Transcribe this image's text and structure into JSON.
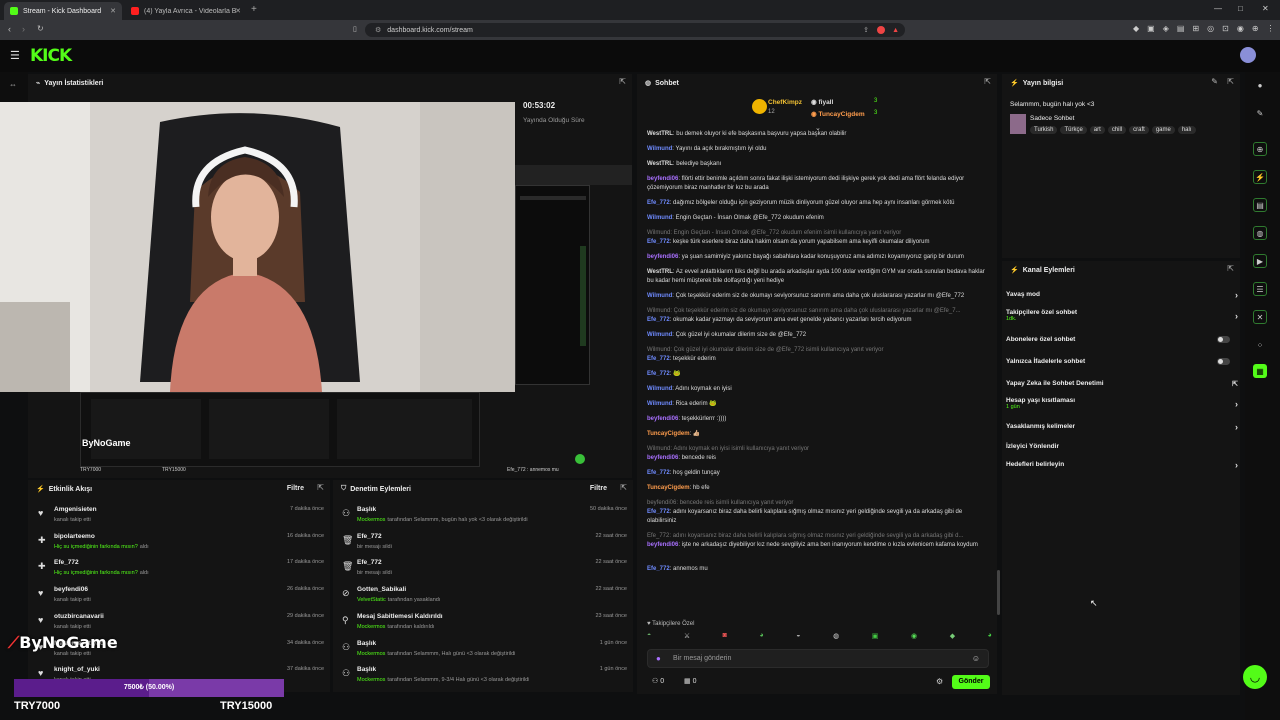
{
  "browser": {
    "tabs": [
      {
        "label": "Stream - Kick Dashboard",
        "active": true
      },
      {
        "label": "(4) Yayla Avrıca - Videolarla Bak (Yo...",
        "active": false
      }
    ],
    "url": "dashboard.kick.com/stream"
  },
  "brand": {
    "logo": "KICK",
    "accent": "#53fc18"
  },
  "stats_panel": {
    "title": "Yayın İstatistikleri",
    "uptime": "00:53:02",
    "uptime_label": "Yayında Olduğu Süre",
    "overlay_name": "ByNoGame",
    "stream_label_a": "TRY7000",
    "stream_label_b": "TRY15000",
    "chat_preview": "Efe_772 : annemos mu"
  },
  "chat": {
    "title": "Sohbet",
    "pinned": [
      {
        "name": "ChefKimpz",
        "count": "3",
        "sub": "12"
      },
      {
        "name": "fiyall",
        "count": "3"
      },
      {
        "name": "TuncayCigdem",
        "count": "3"
      }
    ],
    "messages": [
      {
        "user": "WestTRL",
        "color": "white",
        "text": "bu demek oluyor ki efe başkasına başvuru yapsa başkan olabilir"
      },
      {
        "user": "Wilmund",
        "color": "blue",
        "text": "Yayını da açık bırakmıştım iyi oldu"
      },
      {
        "user": "WestTRL",
        "color": "white",
        "text": "belediye başkanı"
      },
      {
        "user": "beyfendi06",
        "color": "purple",
        "text": "flörti ettir benimle açıldım sonra fakat ilişki istemiyorum dedi ilişkiye gerek yok dedi ama flört felanda ediyor çözemiyorum biraz manhatler bir kız bu arada"
      },
      {
        "user": "Efe_772",
        "color": "blue",
        "text": "dağımız bölgeler olduğu için geziyorum müzik dinliyorum güzel oluyor ama hep aynı insanları görmek kötü"
      },
      {
        "user": "Wilmund",
        "color": "blue",
        "text": "Engin Geçtan - İnsan Olmak @Efe_772 okudum efenim"
      },
      {
        "user": "Efe_772",
        "color": "blue",
        "reply": "Wilmund: Engin Geçtan - İnsan Olmak @Efe_772 okudum efenim isimli kullanıcıya yanıt veriyor",
        "text": "keşke türk eserlere biraz daha hakim olsam da yorum yapabilsem ama keyifli okumalar diliyorum"
      },
      {
        "user": "beyfendi06",
        "color": "purple",
        "text": "ya şuan samimiyiz yakınız bayağı sabahlara kadar konuşuyoruz ama adımızı koyamıyoruz garip bir durum"
      },
      {
        "user": "WestTRL",
        "color": "white",
        "text": "Az evvel anlattıklarım lüks değil bu arada arkadaşlar ayda 100 dolar verdiğim GYM var orada sunulan bedava haklar bu kadar hemi müşterek bile dolfaşrdığı yeni hediye"
      },
      {
        "user": "Wilmund",
        "color": "blue",
        "text": "Çok teşekkür ederim siz de okumayı seviyorsunuz sanırım ama daha çok uluslararası yazarlar mı @Efe_772"
      },
      {
        "user": "Efe_772",
        "color": "blue",
        "reply": "Wilmund: Çok teşekkür ederim siz de okumayı seviyorsunuz sanırım ama daha çok uluslararası yazarlar mı @Efe_7...",
        "text": "okumak kadar yazmayı da seviyorum ama evet genelde yabancı yazarları tercih ediyorum"
      },
      {
        "user": "Wilmund",
        "color": "blue",
        "text": "Çok güzel iyi okumalar dilerim size de @Efe_772"
      },
      {
        "user": "Efe_772",
        "color": "blue",
        "reply": "Wilmund: Çok güzel iyi okumalar dilerim size de @Efe_772 isimli kullanıcıya yanıt veriyor",
        "text": "teşekkür ederim"
      },
      {
        "user": "Efe_772",
        "color": "blue",
        "text": "🐸"
      },
      {
        "user": "Wilmund",
        "color": "blue",
        "text": "Adını koymak en iyisi"
      },
      {
        "user": "Wilmund",
        "color": "blue",
        "text": "Rica ederim 🐸"
      },
      {
        "user": "beyfendi06",
        "color": "purple",
        "text": "teşekkürlerrr :))))"
      },
      {
        "user": "TuncayCigdem",
        "color": "orange",
        "text": "👍🏼"
      },
      {
        "user": "beyfendi06",
        "color": "purple",
        "reply": "Wilmund: Adını koymak en iyisi isimli kullanıcıya yanıt veriyor",
        "text": "bencede reis"
      },
      {
        "user": "Efe_772",
        "color": "blue",
        "text": "hoş geldin tunçay"
      },
      {
        "user": "TuncayCigdem",
        "color": "orange",
        "text": "hb efe"
      },
      {
        "user": "Efe_772",
        "color": "blue",
        "reply": "beyfendi06: bencede reis isimli kullanıcıya yanıt veriyor",
        "text": "adını koyarsanız biraz daha belirli kalıplara sığmış olmaz mısınız yeri geldiğinde sevgili ya da arkadaş gibi de olabilirsiniz"
      },
      {
        "user": "beyfendi06",
        "color": "purple",
        "reply": "Efe_772: adını koyarsanız biraz daha belirli kalıplara sığmış olmaz mısınız yeri geldiğinde sevgili ya da arkadaş gibi d...",
        "text": "işte ne arkadaşız diyebiliyor kız nede sevgiliyiz ama ben inanıyorum kendime o kızla evlenicem kafama koydum"
      },
      {
        "user": "Efe_772",
        "color": "blue",
        "text": "annemos mu"
      }
    ],
    "followers_only": "Takipçilere Özel",
    "input_placeholder": "Bir mesaj gönderin",
    "counter_a": "0",
    "counter_b": "0",
    "send_label": "Gönder"
  },
  "stream_info": {
    "title": "Yayın bilgisi",
    "stream_title": "Selammm, bugün halı yok <3",
    "category": "Sadece Sohbet",
    "tags": [
      "Turkish",
      "Türkçe",
      "art",
      "chill",
      "craft",
      "game",
      "halı"
    ]
  },
  "channel_actions": {
    "title": "Kanal Eylemleri",
    "items": [
      {
        "label": "Yavaş mod",
        "control": "arrow"
      },
      {
        "label": "Takipçilere özel sohbet",
        "sub": "1dk.",
        "control": "arrow"
      },
      {
        "label": "Abonelere özel sohbet",
        "control": "toggle"
      },
      {
        "label": "Yalnızca İfadelerle sohbet",
        "control": "toggle"
      },
      {
        "label": "Yapay Zeka ile Sohbet Denetimi",
        "control": "external"
      },
      {
        "label": "Hesap yaşı kısıtlaması",
        "sub": "1 gün",
        "control": "arrow"
      },
      {
        "label": "Yasaklanmış kelimeler",
        "control": "arrow"
      },
      {
        "label": "İzleyici Yönlendir",
        "control": "none"
      },
      {
        "label": "Hedefleri belirleyin",
        "control": "arrow"
      }
    ]
  },
  "activity": {
    "title": "Etkinlik Akışı",
    "filter": "Filtre",
    "items": [
      {
        "name": "Amgenisieten",
        "text": "kanalı takip etti",
        "time": "7 dakika önce",
        "icon": "heart"
      },
      {
        "name": "bipolarteemo",
        "text": "Hiç su içmediğinin farkında mısın?",
        "text2": "aldı",
        "time": "16 dakika önce",
        "icon": "gift"
      },
      {
        "name": "Efe_772",
        "text": "Hiç su içmediğinin farkında mısın?",
        "text2": "aldı",
        "time": "17 dakika önce",
        "icon": "gift"
      },
      {
        "name": "beyfendi06",
        "text": "kanalı takip etti",
        "time": "26 dakika önce",
        "icon": "heart"
      },
      {
        "name": "otuzbircanavarii",
        "text": "kanalı takip etti",
        "time": "29 dakika önce",
        "icon": "heart"
      },
      {
        "name": "Malzeme ihtiyacı",
        "text": "kanalı takip etti",
        "time": "34 dakika önce",
        "icon": "heart"
      },
      {
        "name": "knight_of_yuki",
        "text": "kanalı takip etti",
        "time": "37 dakika önce",
        "icon": "heart"
      }
    ]
  },
  "moderation": {
    "title": "Denetim Eylemleri",
    "filter": "Filtre",
    "items": [
      {
        "name": "Başlık",
        "actor": "Mockermos",
        "text": "tarafından Selammm, bugün halı yok <3 olarak değiştirildi",
        "time": "50 dakika önce",
        "icon": "person"
      },
      {
        "name": "Efe_772",
        "text": "bir mesajı sildi",
        "time": "22 saat önce",
        "icon": "trash"
      },
      {
        "name": "Efe_772",
        "text": "bir mesajı sildi",
        "time": "22 saat önce",
        "icon": "trash"
      },
      {
        "name": "Gotten_Sabikali",
        "actor": "VelvetStatic",
        "text": "tarafından yasaklandı",
        "time": "22 saat önce",
        "icon": "ban"
      },
      {
        "name": "Mesaj Sabitlemesi Kaldırıldı",
        "actor": "Mockermos",
        "text": "tarafından kaldırıldı",
        "time": "23 saat önce",
        "icon": "pin"
      },
      {
        "name": "Başlık",
        "actor": "Mockermos",
        "text": "tarafından Selammm, Halı günü <3 olarak değiştirildi",
        "time": "1 gün önce",
        "icon": "person"
      },
      {
        "name": "Başlık",
        "actor": "Mockermos",
        "text": "tarafından Selammm, 9-3/4 Halı günü <3 olarak değiştirildi",
        "time": "1 gün önce",
        "icon": "person"
      }
    ]
  },
  "overlay": {
    "brand": "ByNoGame",
    "goal_text": "7500₺ (50.00%)",
    "goal_progress": 0.5,
    "goal_left": "TRY7000",
    "goal_right": "TRY15000"
  }
}
